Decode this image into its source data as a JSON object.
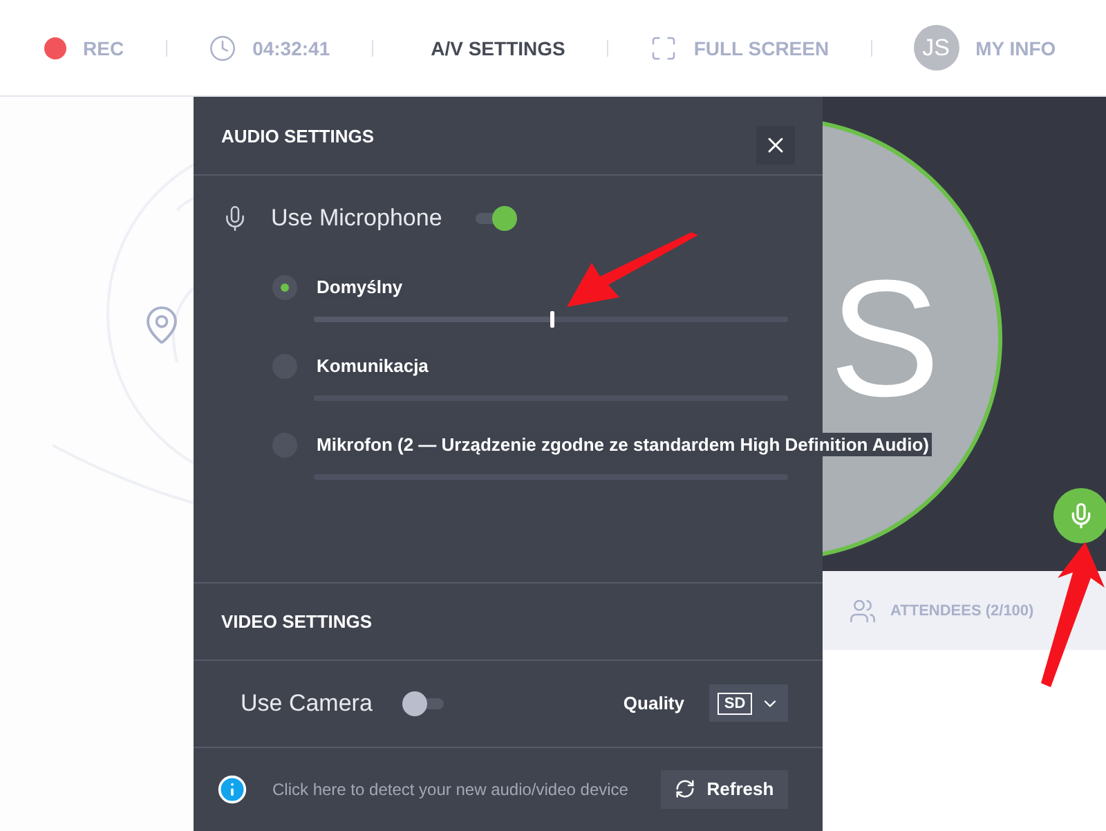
{
  "toolbar": {
    "items": [
      {
        "kind": "rec",
        "label": "REC",
        "selected": false
      },
      {
        "kind": "timer",
        "label": "04:32:41",
        "selected": false
      },
      {
        "kind": "av",
        "label": "A/V SETTINGS",
        "selected": true
      },
      {
        "kind": "fullscreen",
        "label": "FULL SCREEN",
        "selected": false
      },
      {
        "kind": "profile",
        "avatar": "JS",
        "label": "MY INFO",
        "selected": false
      }
    ]
  },
  "stage": {
    "initial": "S",
    "mic_on": true
  },
  "tabs": [
    {
      "kind": "attendees",
      "label": "ATTENDEES (2/100)",
      "selected": false
    }
  ],
  "av_panel": {
    "audio": {
      "title": "AUDIO SETTINGS",
      "use_label": "Use Microphone",
      "on": true,
      "devices": [
        {
          "label": "Domyślny",
          "selected": true,
          "level": 0.5
        },
        {
          "label": "Komunikacja",
          "selected": false,
          "level": 0
        },
        {
          "label": "Mikrofon (2 — Urządzenie zgodne ze standardem High Definition Audio)",
          "selected": false,
          "level": 0
        }
      ]
    },
    "video": {
      "title": "VIDEO SETTINGS",
      "use_label": "Use Camera",
      "on": false,
      "quality_label": "Quality",
      "quality": "SD"
    },
    "hint": "Click here to detect your new audio/video device",
    "refresh": "Refresh"
  }
}
